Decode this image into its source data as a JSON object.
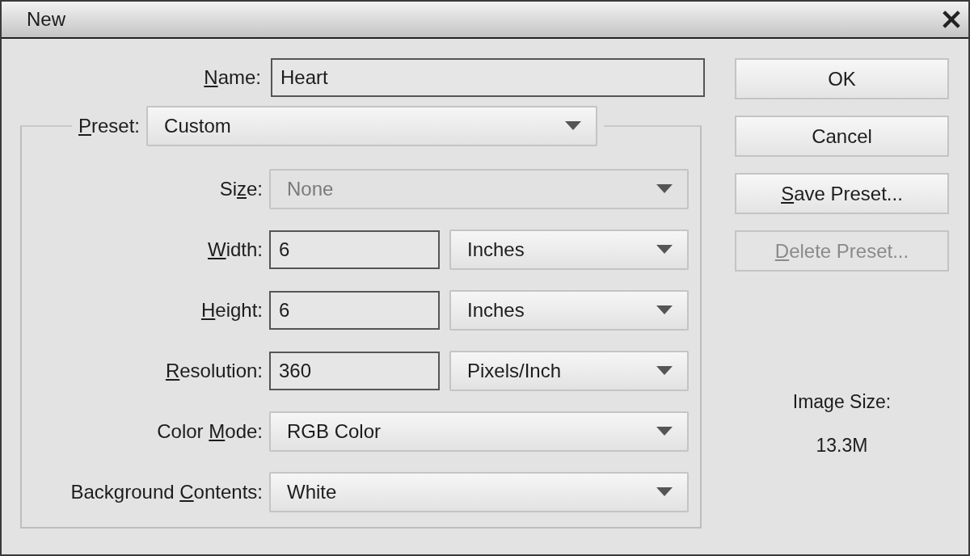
{
  "window": {
    "title": "New"
  },
  "name_field": {
    "label": {
      "key": "N",
      "after": "ame:"
    },
    "value": "Heart"
  },
  "preset": {
    "label": {
      "key": "P",
      "after": "reset:"
    },
    "value": "Custom"
  },
  "fields": [
    {
      "kind": "dropdown",
      "label": {
        "before": "Si",
        "key": "z",
        "after": "e:"
      },
      "value": "None",
      "disabled": true
    },
    {
      "kind": "number",
      "label": {
        "key": "W",
        "after": "idth:"
      },
      "value": "6",
      "unit": "Inches",
      "disabled": false
    },
    {
      "kind": "number",
      "label": {
        "key": "H",
        "after": "eight:"
      },
      "value": "6",
      "unit": "Inches",
      "disabled": false
    },
    {
      "kind": "number",
      "label": {
        "key": "R",
        "after": "esolution:"
      },
      "value": "360",
      "unit": "Pixels/Inch",
      "disabled": false
    },
    {
      "kind": "dropdown",
      "label": {
        "before": "Color ",
        "key": "M",
        "after": "ode:"
      },
      "value": "RGB Color",
      "disabled": false
    },
    {
      "kind": "dropdown",
      "label": {
        "before": "Background ",
        "key": "C",
        "after": "ontents:"
      },
      "value": "White",
      "disabled": false
    }
  ],
  "buttons": [
    {
      "label": {
        "before": "OK"
      },
      "disabled": false
    },
    {
      "label": {
        "before": "Cancel"
      },
      "disabled": false
    },
    {
      "label": {
        "key": "S",
        "after": "ave Preset..."
      },
      "disabled": false
    },
    {
      "label": {
        "key": "D",
        "after": "elete Preset..."
      },
      "disabled": true
    }
  ],
  "image_size": {
    "label": "Image Size:",
    "value": "13.3M"
  }
}
